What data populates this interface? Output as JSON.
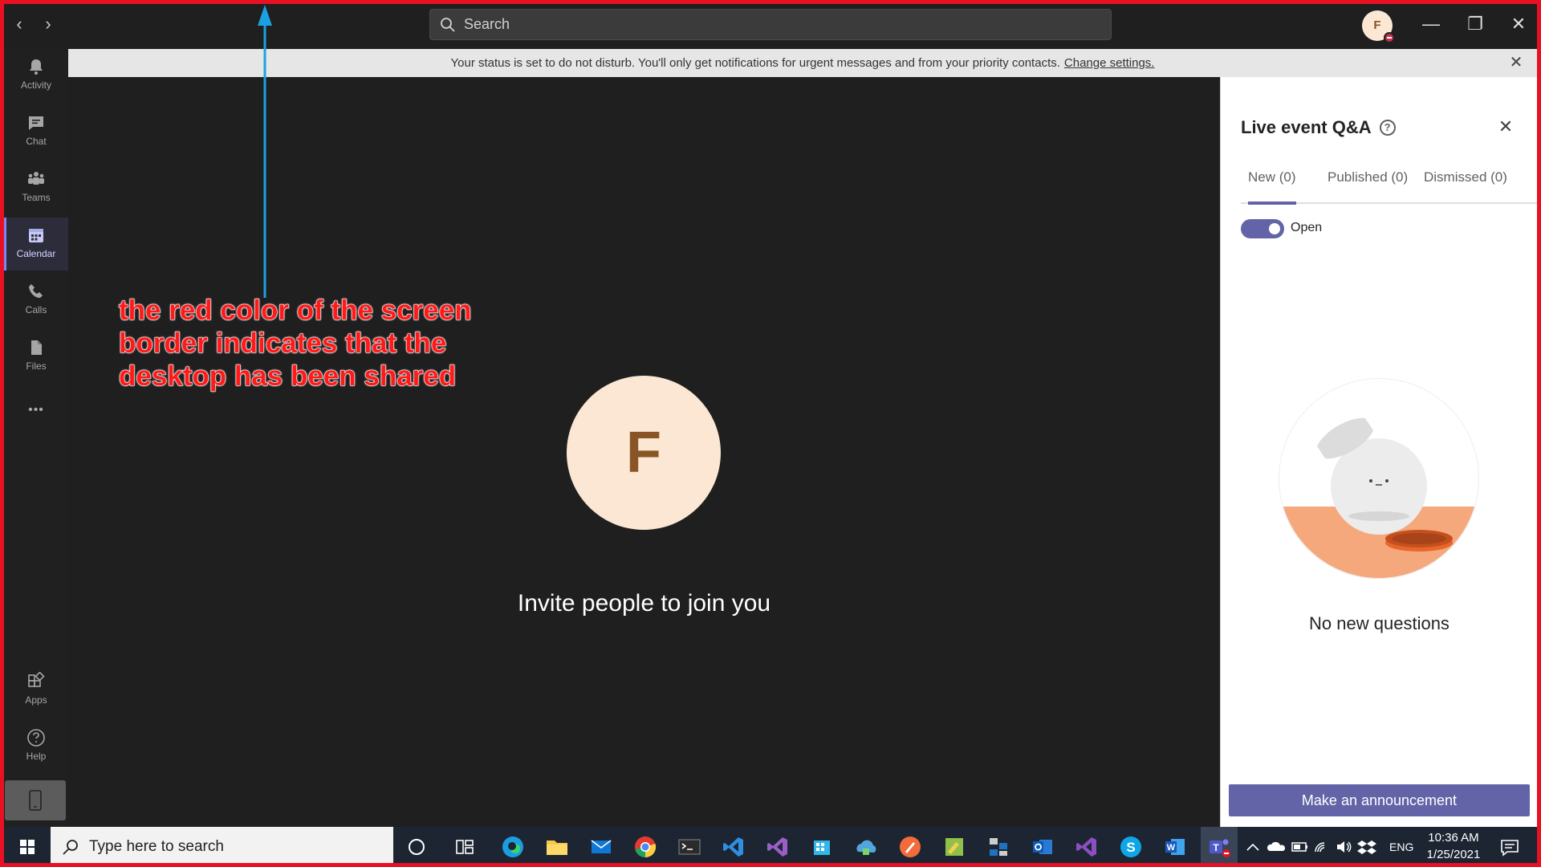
{
  "titlebar": {
    "search_placeholder": "Search",
    "avatar_initial": "F",
    "back_glyph": "‹",
    "forward_glyph": "›",
    "minimize_glyph": "—",
    "maximize_glyph": "❐",
    "close_glyph": "✕"
  },
  "rail": {
    "items": [
      {
        "label": "Activity",
        "icon": "bell-icon"
      },
      {
        "label": "Chat",
        "icon": "chat-icon"
      },
      {
        "label": "Teams",
        "icon": "teams-icon"
      },
      {
        "label": "Calendar",
        "icon": "calendar-icon",
        "active": true
      },
      {
        "label": "Calls",
        "icon": "phone-icon"
      },
      {
        "label": "Files",
        "icon": "files-icon"
      },
      {
        "label": "Apps",
        "icon": "apps-icon"
      },
      {
        "label": "Help",
        "icon": "help-icon"
      }
    ],
    "more_glyph": "•••"
  },
  "banner": {
    "text": "Your status is set to do not disturb. You'll only get notifications for urgent messages and from your priority contacts.",
    "link": "Change settings.",
    "close_glyph": "✕"
  },
  "stage": {
    "avatar_initial": "F",
    "invite_text": "Invite people to join you"
  },
  "annotation": {
    "line1": "the red color of the screen",
    "line2": "border indicates that the",
    "line3": "desktop has been shared"
  },
  "qa": {
    "title": "Live event Q&A",
    "help_glyph": "?",
    "close_glyph": "✕",
    "tabs": [
      {
        "label": "New (0)",
        "active": true
      },
      {
        "label": "Published (0)"
      },
      {
        "label": "Dismissed (0)"
      }
    ],
    "toggle_label": "Open",
    "empty_text": "No new questions",
    "announce_label": "Make an announcement"
  },
  "taskbar": {
    "search_placeholder": "Type here to search",
    "language": "ENG",
    "time": "10:36 AM",
    "date": "1/25/2021",
    "apps": [
      "cortana-icon",
      "task-view-icon",
      "edge-icon",
      "file-explorer-icon",
      "mail-icon",
      "chrome-icon",
      "terminal-icon",
      "vscode-icon",
      "visual-studio-icon",
      "azure-storage-icon",
      "azure-icon",
      "postman-icon",
      "notepad-plus-icon",
      "sql-icon",
      "outlook-icon",
      "visual-studio-preview-icon",
      "skype-icon",
      "word-icon",
      "teams-icon"
    ]
  },
  "colors": {
    "share_border": "#e81123",
    "accent": "#6264a7",
    "annotation": "#ff1a1a",
    "arrow": "#1ba1e2"
  }
}
